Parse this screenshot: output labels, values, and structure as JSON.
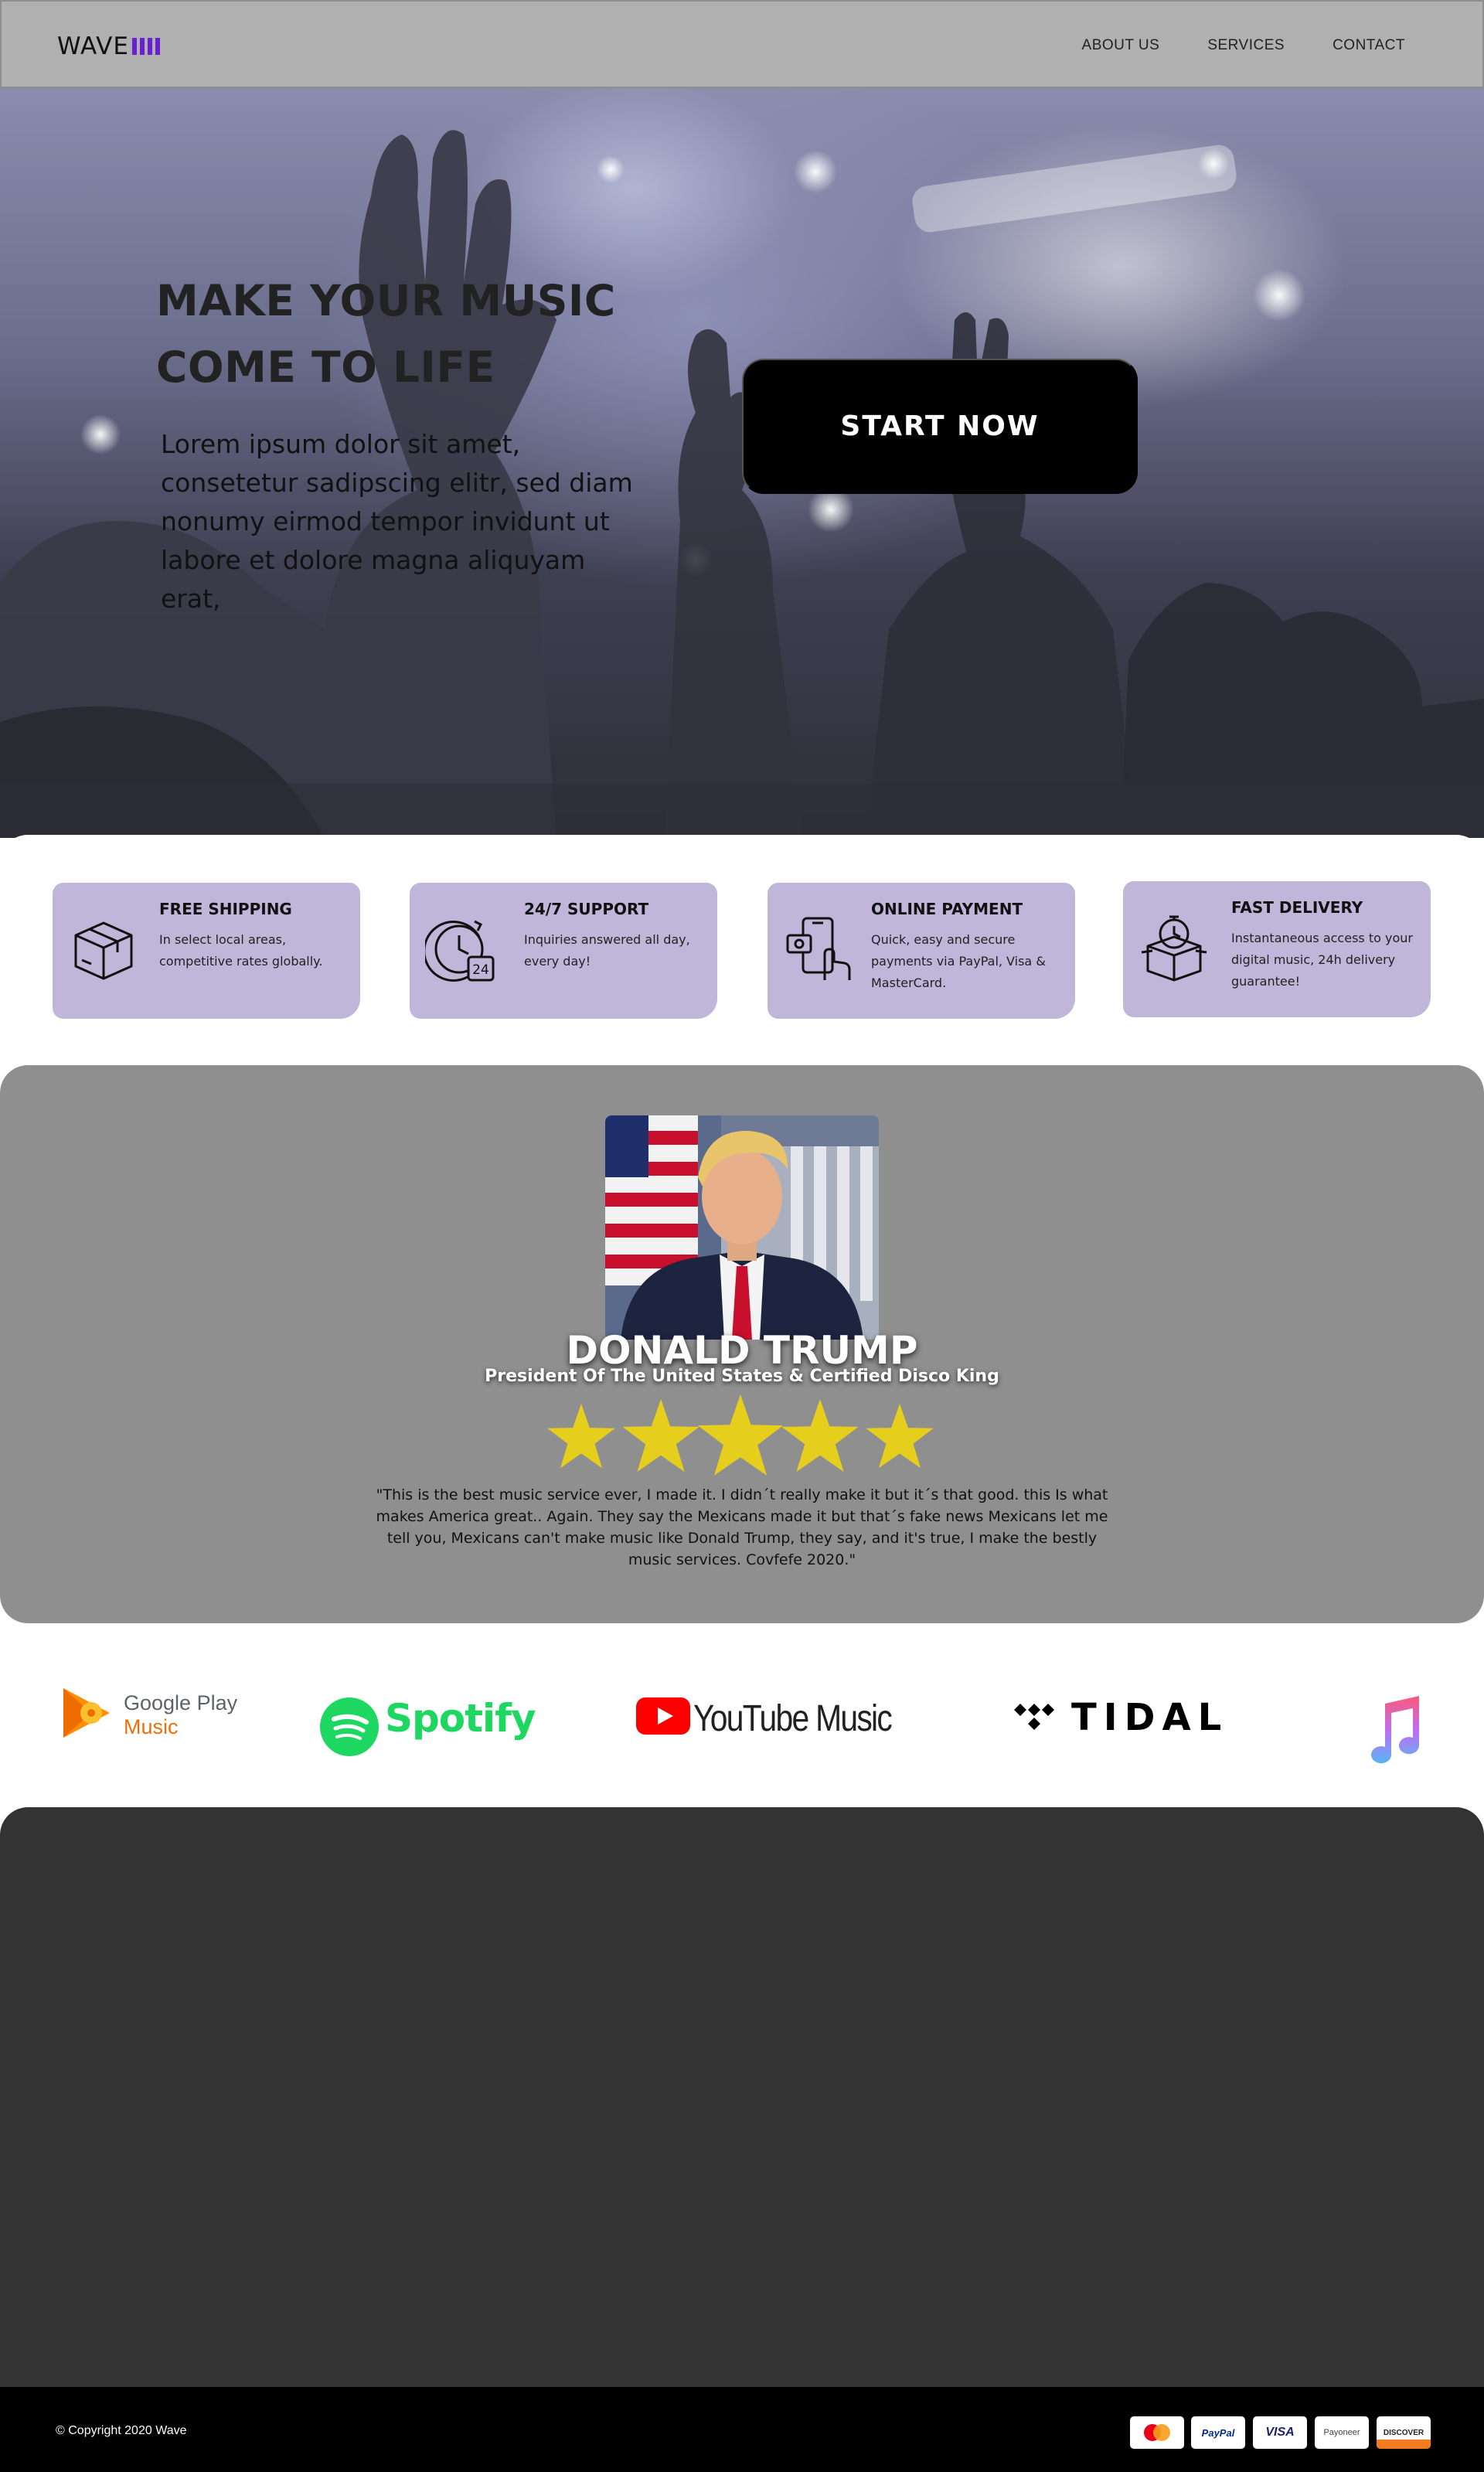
{
  "header": {
    "logo": "WAVE",
    "nav": [
      "ABOUT US",
      "SERVICES",
      "CONTACT"
    ]
  },
  "hero": {
    "title": "MAKE YOUR MUSIC COME TO LIFE",
    "text": "Lorem ipsum dolor sit amet, consetetur sadipscing elitr, sed diam nonumy eirmod tempor invidunt ut labore et dolore magna aliquyam erat,",
    "cta": "START NOW"
  },
  "features": [
    {
      "title": "FREE SHIPPING",
      "text": "In select local areas, competitive rates globally.",
      "icon": "package-box-icon"
    },
    {
      "title": "24/7 SUPPORT",
      "text": "Inquiries answered all day, every day!",
      "icon": "clock-24-icon"
    },
    {
      "title": "ONLINE PAYMENT",
      "text": "Quick, easy and secure payments via PayPal, Visa & MasterCard.",
      "icon": "phone-payment-icon"
    },
    {
      "title": "FAST DELIVERY",
      "text": "Instantaneous access to your digital music, 24h delivery guarantee!",
      "icon": "stopwatch-box-icon"
    }
  ],
  "testimonial": {
    "name": "DONALD TRUMP",
    "role": "President Of The United States & Certified Disco King",
    "rating": 5,
    "quote": "\"This is the best music service ever, I made it. I didn´t really make it but it´s that good. this Is what makes America great.. Again. They say the Mexicans made it but that´s fake news Mexicans let me tell you, Mexicans can't make music like Donald Trump, they say, and it's true, I make the bestly music services. Covfefe 2020.\""
  },
  "partners": {
    "google_play": [
      "Google Play",
      "Music"
    ],
    "spotify": "Spotify",
    "youtube_music": "YouTube Music",
    "tidal": "TIDAL",
    "apple_music": "apple-music-note-icon"
  },
  "footer": {
    "copyright": "© Copyright 2020 Wave",
    "payments": [
      "MasterCard",
      "PayPal",
      "VISA",
      "Payoneer",
      "DISCOVER"
    ]
  },
  "colors": {
    "header_bg": "#b0b0b0",
    "logo_accent": "#6a1fd1",
    "card_bg": "#bfb6da",
    "testimonial_bg": "#8f8f8f",
    "star": "#e6cf1c",
    "dark_section": "#333333",
    "footer_bg": "#000000"
  }
}
